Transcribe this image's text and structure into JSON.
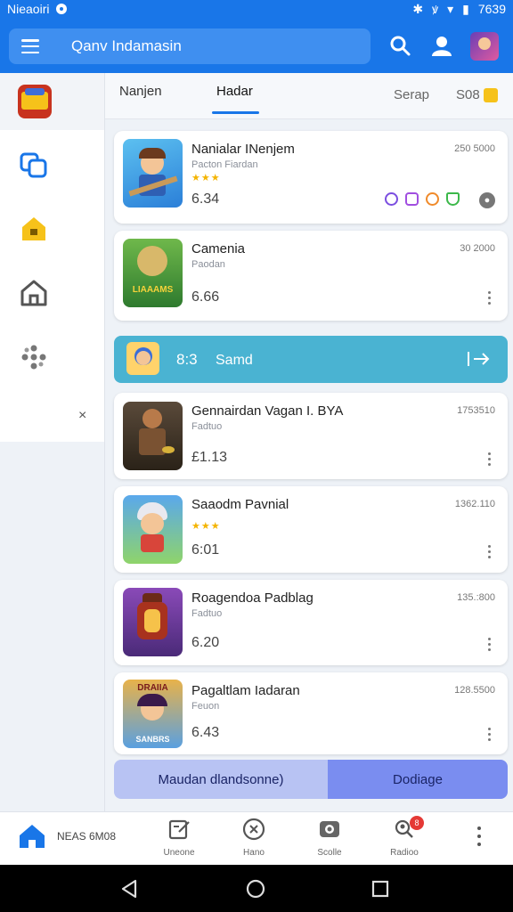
{
  "status_bar": {
    "carrier": "Nieaoiri",
    "time": "7639"
  },
  "app_bar": {
    "search_text": "Qanv Indamasin"
  },
  "sidebar": {
    "close_label": "×"
  },
  "tabs": [
    {
      "label": "Nanjen"
    },
    {
      "label": "Hadar"
    },
    {
      "label": "Serap"
    },
    {
      "label": "S08"
    }
  ],
  "games": [
    {
      "title": "Nanialar INenjem",
      "sub": "Pacton Fiardan",
      "price": "6.34",
      "count": "250 5000",
      "stars": "★★★"
    },
    {
      "title": "Camenia",
      "sub": "Paodan",
      "price": "6.66",
      "count": "30 2000"
    },
    {
      "title": "Gennairdan Vagan I. BYA",
      "sub": "Fadtuo",
      "price": "£1.13",
      "count": "1753510"
    },
    {
      "title": "Saaodm Pavnial",
      "sub": "",
      "price": "6:01",
      "count": "1362.110",
      "stars": "★★★"
    },
    {
      "title": "Roagendoa Padblag",
      "sub": "Fadtuo",
      "price": "6.20",
      "count": "135.:800"
    },
    {
      "title": "Pagaltlam Iadaran",
      "sub": "Feuon",
      "price": "6.43",
      "count": "128.5500"
    }
  ],
  "thumb_texts": {
    "game2": "LIAAAMS",
    "game6_top": "DRAIIA",
    "game6_bottom": "SANBRS"
  },
  "banner": {
    "code": "8:3",
    "label": "Samd"
  },
  "cta": {
    "left": "Maudan dlandsonne)",
    "right": "Dodiage"
  },
  "bottom_nav": [
    {
      "label": "NEAS 6M08"
    },
    {
      "label": "Uneone"
    },
    {
      "label": "Hano"
    },
    {
      "label": "Scolle"
    },
    {
      "label": "Radioo",
      "badge": "8"
    }
  ],
  "colors": {
    "primary": "#1976e8",
    "banner": "#4ab3d2",
    "cta_left": "#b8c3f3",
    "cta_right": "#7a8df0",
    "star": "#f4b400"
  }
}
